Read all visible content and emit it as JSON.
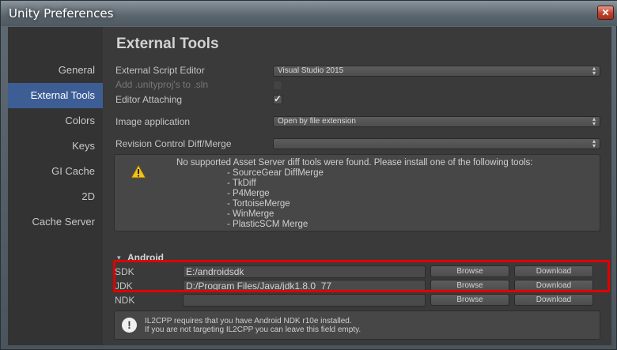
{
  "window": {
    "title": "Unity Preferences",
    "close_glyph": "✕"
  },
  "sidebar": {
    "items": [
      {
        "label": "General",
        "active": false
      },
      {
        "label": "External Tools",
        "active": true
      },
      {
        "label": "Colors",
        "active": false
      },
      {
        "label": "Keys",
        "active": false
      },
      {
        "label": "GI Cache",
        "active": false
      },
      {
        "label": "2D",
        "active": false
      },
      {
        "label": "Cache Server",
        "active": false
      }
    ]
  },
  "main": {
    "title": "External Tools",
    "external_script_editor": {
      "label": "External Script Editor",
      "value": "Visual Studio 2015"
    },
    "add_unityproj": {
      "label": "Add .unityproj's to .sln",
      "checked": false,
      "enabled": false
    },
    "editor_attaching": {
      "label": "Editor Attaching",
      "checked": true
    },
    "image_application": {
      "label": "Image application",
      "value": "Open by file extension"
    },
    "revision_control": {
      "label": "Revision Control Diff/Merge",
      "value": ""
    },
    "diff_help": {
      "icon": "warning-icon",
      "lines": [
        "No supported Asset Server diff tools were found. Please install one of the following tools:",
        "- SourceGear DiffMerge",
        "- TkDiff",
        "- P4Merge",
        "- TortoiseMerge",
        "- WinMerge",
        "- PlasticSCM Merge"
      ]
    },
    "android": {
      "title": "Android",
      "sdk": {
        "label": "SDK",
        "value": "E:/androidsdk",
        "browse": "Browse",
        "download": "Download"
      },
      "jdk": {
        "label": "JDK",
        "value": "D:/Program Files/Java/jdk1.8.0_77",
        "browse": "Browse",
        "download": "Download"
      },
      "ndk": {
        "label": "NDK",
        "value": "",
        "browse": "Browse",
        "download": "Download"
      },
      "ndk_help": {
        "icon": "info-icon",
        "line1": "IL2CPP requires that you have Android NDK r10e installed.",
        "line2": "If you are not targeting IL2CPP you can leave this field empty."
      }
    }
  },
  "colors": {
    "accent": "#3d5d95",
    "highlight": "#e00000"
  }
}
